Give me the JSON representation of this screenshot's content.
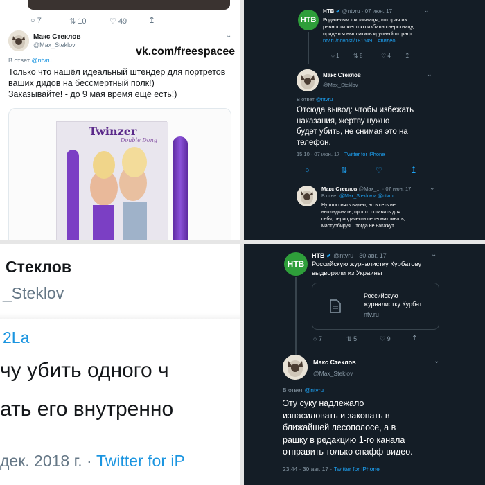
{
  "q1": {
    "stats": {
      "reply": "7",
      "retweet": "10",
      "like": "49"
    },
    "author_name": "Макс Стеклов",
    "author_handle": "@Max_Steklov",
    "reply_prefix": "В ответ",
    "reply_to": "@ntvru",
    "watermark": "vk.com/freespacee",
    "text_line1": "Только что нашёл идеальный штендер для портретов",
    "text_line2": "ваших дидов на бессмертный полк!)",
    "text_line3": "Заказывайте! - до 9 мая время ещё есть!)",
    "product_brand": "Twinzer",
    "product_sub": "Double Dong"
  },
  "q2": {
    "ntv_name": "НТВ",
    "ntv_handle": "@ntvru",
    "ntv_date": "07 июн. 17",
    "ntv_text_line1": "Родителям школьницы, которая из",
    "ntv_text_line2": "ревности жестоко избила сверстницу,",
    "ntv_text_line3": "придется выплатить крупный штраф",
    "ntv_link": "ntv.ru/novosti/181649... #видео",
    "ntv_stats": {
      "reply": "1",
      "retweet": "8",
      "like": "4"
    },
    "author_name": "Макс Стеклов",
    "author_handle": "@Max_Steklov",
    "reply_prefix": "В ответ",
    "reply_to": "@ntvru",
    "text_line1": "Отсюда вывод: чтобы избежать",
    "text_line2": "наказания, жертву нужно",
    "text_line3": "будет убить, не снимая это на",
    "text_line4": "телефон.",
    "time": "15:10 · 07 июн. 17 ·",
    "client": "Twitter for iPhone",
    "reply2_name": "Макс Стеклов",
    "reply2_handle": "@Max_...",
    "reply2_date": "07 июн. 17",
    "reply2_prefix": "В ответ",
    "reply2_to": "@Max_Steklov и @ntvru",
    "reply2_line1": "Ну или снять видео, но в сеть не",
    "reply2_line2": "выкладывать; просто оставить для",
    "reply2_line3": "себя, периодически пересматривать,",
    "reply2_line4": "мастурбируя... тогда не накажут."
  },
  "q3": {
    "name": "Стеклов",
    "handle": "_Steklov",
    "mention": "2La",
    "text_line1": "чу убить одного ч",
    "text_line2": "ать его внутренно",
    "footer_date": "дек. 2018 г. ·",
    "footer_client": "Twitter for iP"
  },
  "q4": {
    "ntv_name": "НТВ",
    "ntv_handle": "@ntvru",
    "ntv_date": "30 авг. 17",
    "ntv_text_line1": "Российскую журналистку Курбатову",
    "ntv_text_line2": "выдворили из Украины",
    "card_title_line1": "Российскую",
    "card_title_line2": "журналистку Курбат...",
    "card_domain": "ntv.ru",
    "ntv_stats": {
      "reply": "7",
      "retweet": "5",
      "like": "9"
    },
    "author_name": "Макс Стеклов",
    "author_handle": "@Max_Steklov",
    "reply_prefix": "В ответ",
    "reply_to": "@ntvru",
    "text_line1": "Эту суку надлежало",
    "text_line2": "изнасиловать и закопать в",
    "text_line3": "ближайшей лесополосе, а в",
    "text_line4": "рашку в редакцию 1-го канала",
    "text_line5": "отправить только снафф-видео.",
    "time": "23:44 · 30 авг. 17 ·",
    "client": "Twitter for iPhone"
  },
  "colors": {
    "dark_bg": "#141d26",
    "accent_blue": "#1da1f2",
    "ntv_green": "#2e9e3a",
    "purple": "#7b3fc4"
  },
  "icons": [
    "reply-icon",
    "retweet-icon",
    "like-icon",
    "share-icon",
    "chevron-down-icon",
    "verified-icon",
    "document-icon"
  ]
}
